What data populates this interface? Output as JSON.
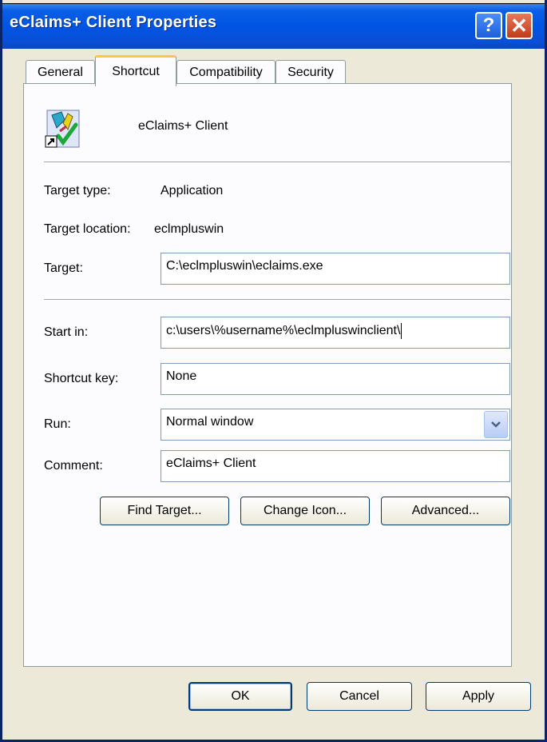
{
  "window": {
    "title": "eClaims+ Client Properties",
    "help_glyph": "?",
    "close_glyph": "✕"
  },
  "tabs": [
    {
      "label": "General"
    },
    {
      "label": "Shortcut",
      "active": true
    },
    {
      "label": "Compatibility"
    },
    {
      "label": "Security"
    }
  ],
  "shortcut": {
    "app_name": "eClaims+ Client",
    "target_type_label": "Target type:",
    "target_type_value": "Application",
    "target_location_label": "Target location:",
    "target_location_value": "eclmpluswin",
    "target_label": "Target:",
    "target_value": "C:\\eclmpluswin\\eclaims.exe",
    "start_in_label": "Start in:",
    "start_in_value": "c:\\users\\%username%\\eclmpluswinclient\\",
    "shortcut_key_label": "Shortcut key:",
    "shortcut_key_value": "None",
    "run_label": "Run:",
    "run_value": "Normal window",
    "comment_label": "Comment:",
    "comment_value": "eClaims+ Client",
    "find_target_label": "Find Target...",
    "change_icon_label": "Change Icon...",
    "advanced_label": "Advanced..."
  },
  "footer": {
    "ok_label": "OK",
    "cancel_label": "Cancel",
    "apply_label": "Apply"
  },
  "colors": {
    "titlebar": "#0054e3",
    "dialog_bg": "#ece9d8",
    "tab_highlight": "#ffc83c"
  }
}
